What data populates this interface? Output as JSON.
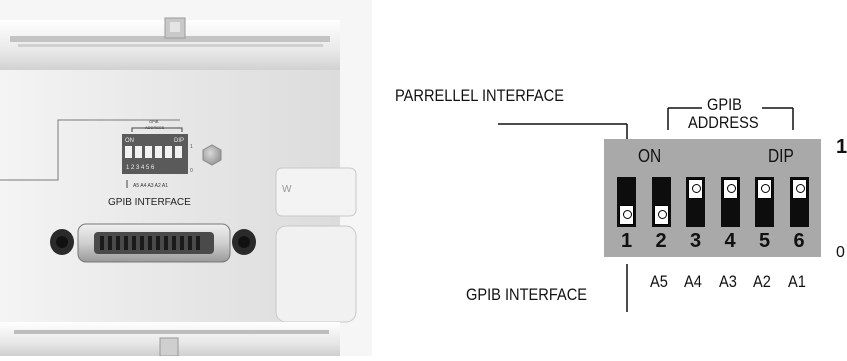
{
  "photo": {
    "address_label_line1": "GPIB",
    "address_label_line2": "ADDRESS",
    "switch_on": "ON",
    "switch_dip": "DIP",
    "switch_numbers": "1 2 3 4 5 6",
    "state_1": "1",
    "state_0": "0",
    "address_bits": "A5 A4 A3 A2 A1",
    "interface_label": "GPIB INTERFACE",
    "side_label": "W"
  },
  "diagram": {
    "parallel_label": "PARRELLEL INTERFACE",
    "gpib_address_line1": "GPIB",
    "gpib_address_line2": "ADDRESS",
    "on_label": "ON",
    "dip_label": "DIP",
    "state_high": "1",
    "state_low": "0",
    "gpib_interface_label": "GPIB  INTERFACE",
    "switches": [
      {
        "number": "1",
        "address": "",
        "position": "down"
      },
      {
        "number": "2",
        "address": "A5",
        "position": "down"
      },
      {
        "number": "3",
        "address": "A4",
        "position": "up"
      },
      {
        "number": "4",
        "address": "A3",
        "position": "up"
      },
      {
        "number": "5",
        "address": "A2",
        "position": "up"
      },
      {
        "number": "6",
        "address": "A1",
        "position": "up"
      }
    ]
  },
  "colors": {
    "switch_body": "#a9a9a9",
    "switch_black": "#0d0d0d",
    "switch_white": "#ffffff",
    "panel_light": "#ececec",
    "panel_mid": "#c8c8c8"
  }
}
